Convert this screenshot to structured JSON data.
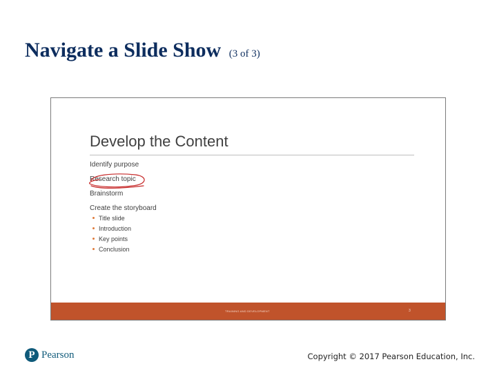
{
  "header": {
    "title": "Navigate a Slide Show",
    "title_suffix": "(3 of 3)"
  },
  "slide": {
    "title": "Develop the Content",
    "items": [
      {
        "text": "Identify purpose",
        "level": 1
      },
      {
        "text": "Research topic",
        "level": 1,
        "annotated": true
      },
      {
        "text": "Brainstorm",
        "level": 1
      },
      {
        "text": "Create the storyboard",
        "level": 1
      },
      {
        "text": "Title slide",
        "level": 2
      },
      {
        "text": "Introduction",
        "level": 2
      },
      {
        "text": "Key points",
        "level": 2
      },
      {
        "text": "Conclusion",
        "level": 2
      }
    ],
    "footer_text": "TRAINING AND DEVELOPMENT",
    "slide_number": "3",
    "colors": {
      "footer_bar": "#c0532b",
      "bullet": "#e07a3a",
      "ink_annotation": "#c62828"
    }
  },
  "footer": {
    "logo_text": "Pearson",
    "logo_icon": "pearson-p-icon",
    "copyright": "Copyright © 2017 Pearson Education, Inc."
  },
  "colors": {
    "title": "#0d2d5e",
    "brand": "#0f5a7a"
  }
}
